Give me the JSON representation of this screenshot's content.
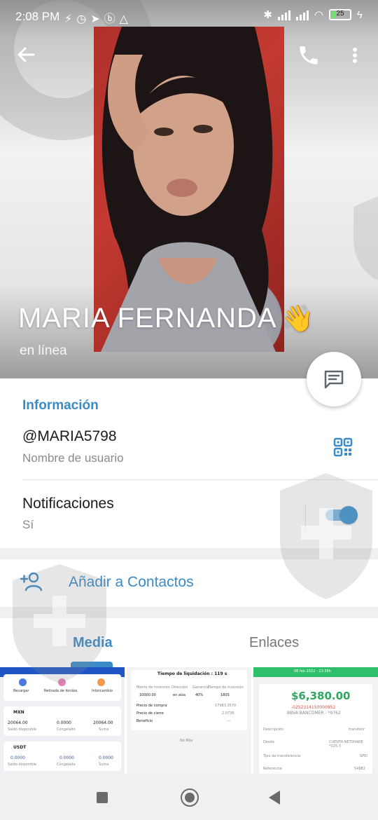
{
  "status_bar": {
    "time": "2:08 PM",
    "battery_level": "25",
    "battery_fraction": 0.25
  },
  "profile": {
    "name": "MARIA FERNANDA",
    "emoji": "👋",
    "status": "en línea"
  },
  "info": {
    "section_title": "Información",
    "username": "@MARIA5798",
    "username_caption": "Nombre de usuario",
    "notifications_label": "Notificaciones",
    "notifications_value": "Sí",
    "notifications_enabled": true
  },
  "actions": {
    "add_contact": "Añadir a Contactos"
  },
  "tabs": [
    {
      "label": "Media",
      "active": true
    },
    {
      "label": "Enlaces",
      "active": false
    }
  ],
  "media": {
    "thumb1": {
      "icon_labels": [
        "Recargar",
        "Retirada de fondos",
        "Intercambio"
      ],
      "rows": [
        {
          "coin": "MXN",
          "values": [
            "20064.00",
            "0.0000",
            "20064.00"
          ],
          "captions": [
            "Saldo disponible",
            "Congelado",
            "Suma"
          ]
        },
        {
          "coin": "USDT",
          "values": [
            "0.0000",
            "0.0000",
            "0.0000"
          ],
          "captions": [
            "Saldo disponible",
            "Congelado",
            "Suma"
          ]
        }
      ]
    },
    "thumb2": {
      "title": "Tiempo de liquidación : 119 s",
      "headers": [
        "Monto de inversión",
        "Dirección",
        "Ganancia",
        "Tiempo de inversión"
      ],
      "row": [
        "10000.00",
        "en alza",
        "40%",
        "180S"
      ],
      "lines": [
        {
          "label": "Precio de compra",
          "value": "17983.3570"
        },
        {
          "label": "Precio de cierre",
          "value": "2.0736"
        },
        {
          "label": "Beneficio",
          "value": "----"
        }
      ],
      "footer": "No Más"
    },
    "thumb3": {
      "date": "08 feb 2022 - 23:38h",
      "amount": "$6,380.00",
      "account": "-0252314150000952",
      "bank": "BBVA BANCOMER - *9762",
      "fields": [
        {
          "label": "Descripción",
          "value": "transferir"
        },
        {
          "label": "Desde",
          "value": "CUENTA NETSHARE *025-3"
        },
        {
          "label": "Tipo de transferencia",
          "value": "SPEI"
        },
        {
          "label": "Referencia",
          "value": "54982"
        }
      ]
    }
  },
  "colors": {
    "accent": "#3a8bc6",
    "toggle_track": "#74b5e3",
    "toggle_knob": "#3e92cf",
    "photo_background": "#c33a31"
  }
}
